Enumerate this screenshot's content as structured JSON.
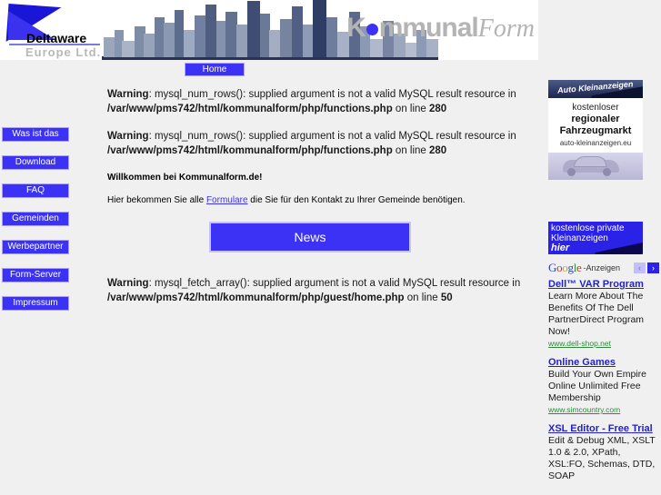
{
  "header": {
    "logo": {
      "name": "Deltaware",
      "subtitle": "Europe Ltd."
    },
    "brand": {
      "part1": "K",
      "part2": "mmunal",
      "part3": "Form"
    }
  },
  "topnav": {
    "home_label": "Home"
  },
  "sidebar": {
    "items": [
      {
        "label": "Was ist das"
      },
      {
        "label": "Download"
      },
      {
        "label": "FAQ"
      },
      {
        "label": "Gemeinden"
      },
      {
        "label": "Werbepartner"
      },
      {
        "label": "Form-Server"
      },
      {
        "label": "Impressum"
      }
    ]
  },
  "main": {
    "warnings": [
      {
        "label": "Warning",
        "message": ": mysql_num_rows(): supplied argument is not a valid MySQL result resource in ",
        "path": "/var/www/pms742/html/kommunalform/php/functions.php",
        "online": " on line ",
        "line": "280"
      },
      {
        "label": "Warning",
        "message": ": mysql_num_rows(): supplied argument is not a valid MySQL result resource in ",
        "path": "/var/www/pms742/html/kommunalform/php/functions.php",
        "online": " on line ",
        "line": "280"
      }
    ],
    "welcome": "Willkommen bei Kommunalform.de!",
    "intro_before": "Hier bekommen Sie alle ",
    "intro_link": "Formulare",
    "intro_after": " die Sie für den Kontakt zu Ihrer Gemeinde benötigen.",
    "news_label": "News",
    "warning3": {
      "label": "Warning",
      "message": ": mysql_fetch_array(): supplied argument is not a valid MySQL result resource in ",
      "path": "/var/www/pms742/html/kommunalform/php/guest/home.php",
      "online": " on line ",
      "line": "50"
    }
  },
  "rail": {
    "ad_auto": {
      "banner_text": "Auto Kleinanzeigen",
      "line1": "kostenloser",
      "line2": "regionaler",
      "line3": "Fahrzeugmarkt",
      "line4": "auto-kleinanzeigen.eu"
    },
    "ad_kleinanzeigen": {
      "line1": "kostenlose private",
      "line2": "Kleinanzeigen",
      "line3": "hier"
    },
    "google": {
      "logo_g": "G",
      "logo_o1": "o",
      "logo_o2": "o",
      "logo_g2": "g",
      "logo_l": "l",
      "logo_e": "e",
      "label": "-Anzeigen",
      "prev": "‹",
      "next": "›",
      "ads": [
        {
          "title": "Dell™ VAR Program",
          "desc": "Learn More About The Benefits Of The Dell PartnerDirect Program Now!",
          "url": "www.dell-shop.net"
        },
        {
          "title": "Online Games",
          "desc": "Build Your Own Empire Online Unlimited Free Membership",
          "url": "www.simcountry.com"
        },
        {
          "title": "XSL Editor - Free Trial",
          "desc": "Edit & Debug XML, XSLT 1.0 & 2.0, XPath, XSL:FO, Schemas, DTD, SOAP",
          "url": ""
        }
      ]
    }
  },
  "colors": {
    "accent_blue": "#3b32f5",
    "link_blue": "#2222cc",
    "page_bg": "#f0f0f0",
    "brand_gray": "#b4b4b4",
    "url_green": "#2f8a3b"
  }
}
